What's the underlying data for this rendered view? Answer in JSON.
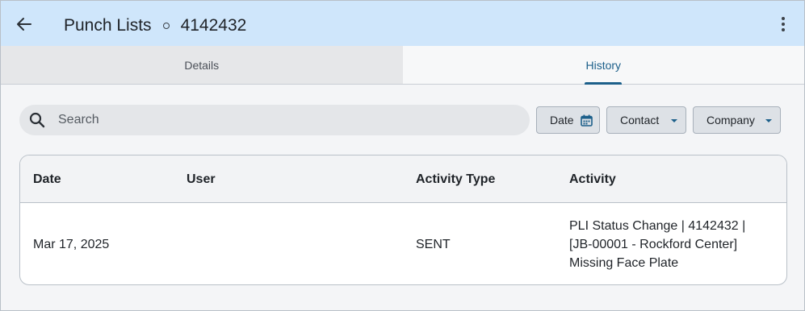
{
  "header": {
    "back_label": "Back",
    "title": "Punch Lists",
    "record_id": "4142432",
    "bg_color": "#cfe6fb"
  },
  "tabs": [
    {
      "label": "Details",
      "active": false
    },
    {
      "label": "History",
      "active": true
    }
  ],
  "search": {
    "placeholder": "Search",
    "value": ""
  },
  "filters": {
    "date_label": "Date",
    "contact_label": "Contact",
    "company_label": "Company"
  },
  "table": {
    "columns": [
      "Date",
      "User",
      "Activity Type",
      "Activity"
    ],
    "rows": [
      {
        "date": "Mar 17, 2025",
        "user": "",
        "activity_type": "SENT",
        "activity": "PLI Status Change | 4142432 | [JB-00001 - Rockford Center] Missing Face Plate"
      }
    ]
  },
  "colors": {
    "accent": "#1c5f8a",
    "header_bg": "#cfe6fb"
  }
}
